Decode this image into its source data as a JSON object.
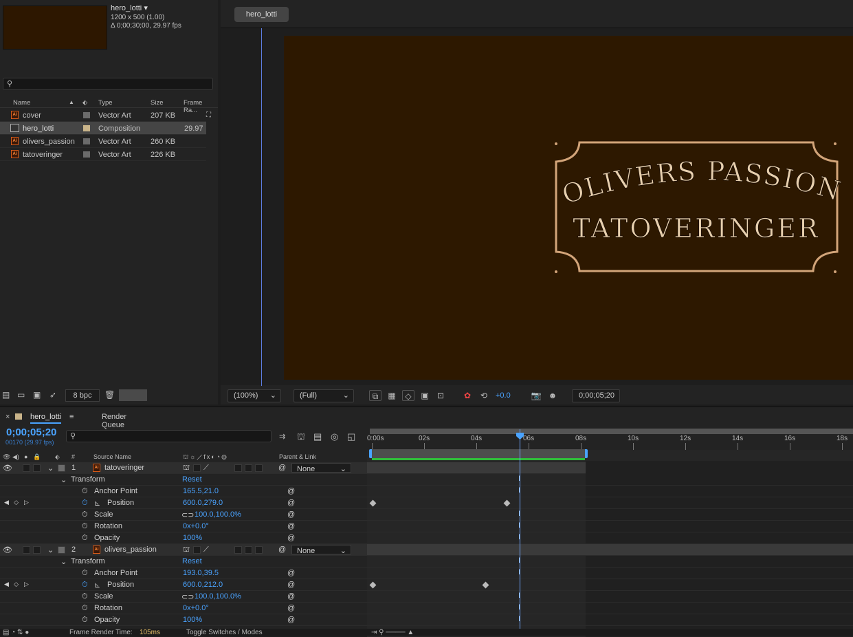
{
  "project": {
    "comp_name": "hero_lotti",
    "comp_size": "1200 x 500 (1.00)",
    "comp_duration": "Δ 0;00;30;00, 29.97 fps",
    "columns": {
      "name": "Name",
      "type": "Type",
      "size": "Size",
      "frame_rate": "Frame Ra..."
    },
    "items": [
      {
        "name": "cover",
        "type": "Vector Art",
        "size": "207 KB",
        "fps": ""
      },
      {
        "name": "hero_lotti",
        "type": "Composition",
        "size": "",
        "fps": "29.97"
      },
      {
        "name": "olivers_passion",
        "type": "Vector Art",
        "size": "260 KB",
        "fps": ""
      },
      {
        "name": "tatoveringer",
        "type": "Vector Art",
        "size": "226 KB",
        "fps": ""
      }
    ],
    "bpc": "8 bpc"
  },
  "viewer": {
    "tab": "hero_lotti",
    "artwork": {
      "line1": "OLIVERS PASSION",
      "line2": "TATOVERINGER"
    },
    "zoom": "(100%)",
    "resolution": "(Full)",
    "exposure": "+0.0",
    "timecode": "0;00;05;20"
  },
  "timeline": {
    "tab": "hero_lotti",
    "render_queue": "Render Queue",
    "timecode": "0;00;05;20",
    "fps_info": "00170 (29.97 fps)",
    "col_hash": "#",
    "col_source": "Source Name",
    "col_parent": "Parent & Link",
    "ruler": [
      "0:00s",
      "02s",
      "04s",
      "06s",
      "08s",
      "10s",
      "12s",
      "14s",
      "16s",
      "18s"
    ],
    "layers": [
      {
        "index": "1",
        "name": "tatoveringer",
        "parent": "None",
        "transform": "Transform",
        "reset": "Reset",
        "props": [
          {
            "name": "Anchor Point",
            "value": "165.5,21.0"
          },
          {
            "name": "Position",
            "value": "600.0,279.0"
          },
          {
            "name": "Scale",
            "value": "100.0,100.0%"
          },
          {
            "name": "Rotation",
            "value": "0x+0.0°"
          },
          {
            "name": "Opacity",
            "value": "100%"
          }
        ]
      },
      {
        "index": "2",
        "name": "olivers_passion",
        "parent": "None",
        "transform": "Transform",
        "reset": "Reset",
        "props": [
          {
            "name": "Anchor Point",
            "value": "193.0,39.5"
          },
          {
            "name": "Position",
            "value": "600.0,212.0"
          },
          {
            "name": "Scale",
            "value": "100.0,100.0%"
          },
          {
            "name": "Rotation",
            "value": "0x+0.0°"
          },
          {
            "name": "Opacity",
            "value": "100%"
          }
        ]
      }
    ],
    "footer": {
      "render_time_label": "Frame Render Time:",
      "render_time": "105ms",
      "toggle": "Toggle Switches / Modes"
    }
  },
  "colors": {
    "accent": "#4aa3ff",
    "canvas_bg": "#2d1800",
    "frame": "#d2a479",
    "green_bar": "#2fbf3a"
  }
}
